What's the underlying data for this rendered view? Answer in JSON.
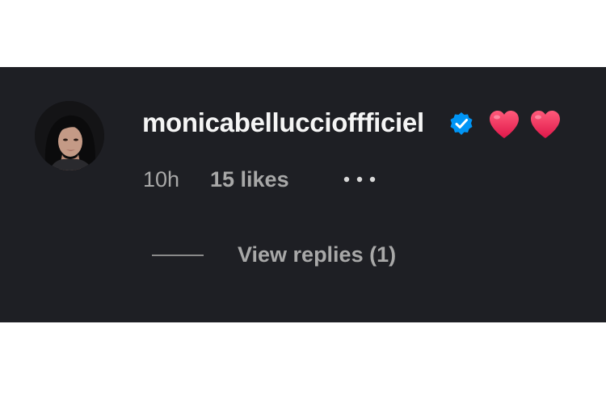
{
  "comment": {
    "username": "monicabelluccioffficiel",
    "verified_icon": "verified-badge-icon",
    "emojis": [
      "heart-icon",
      "heart-icon"
    ],
    "time": "10h",
    "likes": "15 likes",
    "more_icon": "more-options-icon",
    "view_replies": "View replies (1)"
  },
  "colors": {
    "background": "#1e1f24",
    "username": "#f5f5f5",
    "secondary_text": "#a8a8a8",
    "verified": "#0095f6",
    "heart": "#f0305a"
  }
}
